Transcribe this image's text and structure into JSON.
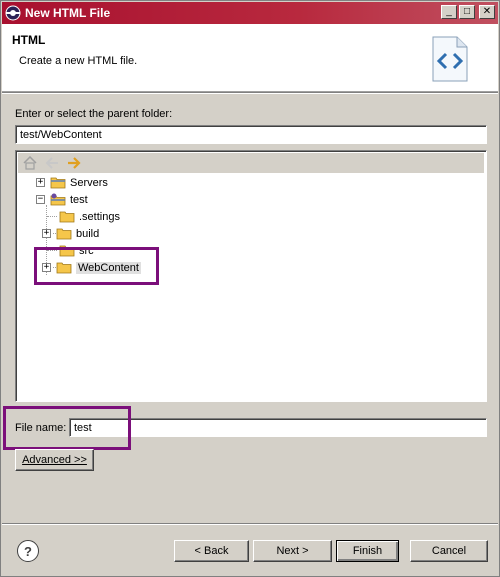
{
  "window": {
    "title": "New HTML File",
    "minimize_glyph": "_",
    "maximize_glyph": "□",
    "close_glyph": "✕"
  },
  "header": {
    "title": "HTML",
    "description": "Create a new HTML file."
  },
  "parent_folder": {
    "label": "Enter or select the parent folder:",
    "value": "test/WebContent"
  },
  "tree": {
    "nodes": [
      {
        "label": "Servers",
        "expander": "+"
      },
      {
        "label": "test",
        "expander": "−"
      },
      {
        "label": ".settings",
        "expander": ""
      },
      {
        "label": "build",
        "expander": "+"
      },
      {
        "label": "src",
        "expander": ""
      },
      {
        "label": "WebContent",
        "expander": "+"
      }
    ]
  },
  "file_name": {
    "label": "File name:",
    "value": "test"
  },
  "advanced_button": "Advanced >>",
  "buttons": {
    "back": "< Back",
    "next": "Next >",
    "finish": "Finish",
    "cancel": "Cancel"
  },
  "colors": {
    "highlight": "#7b0f7a",
    "folder": "#f5c64a"
  }
}
